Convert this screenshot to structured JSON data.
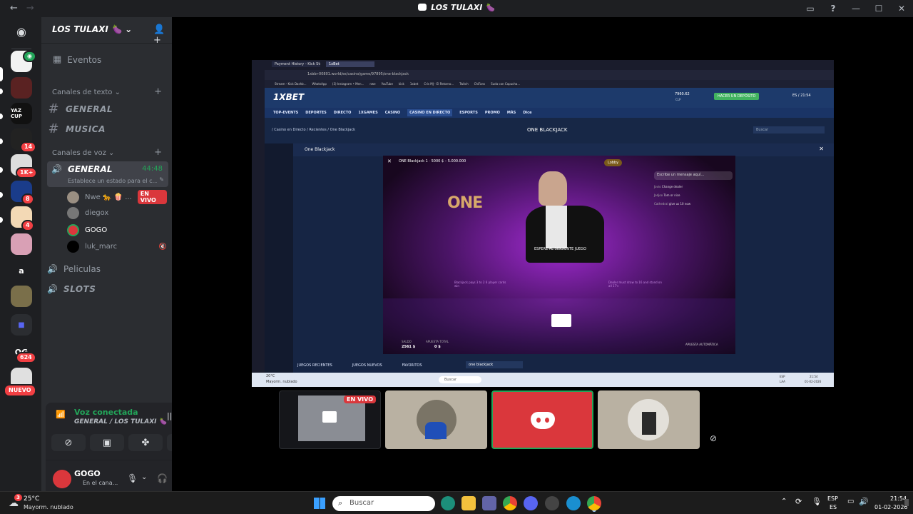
{
  "window": {
    "title": "LOS TULAXI 🍆",
    "back": "←",
    "forward": "→"
  },
  "colors": {
    "accent_green": "#23a559",
    "live_red": "#da373c",
    "badge_red": "#f23f43",
    "discord_blurple": "#5865f2",
    "bet_green": "#41b35f"
  },
  "guild_badges": [
    {
      "count": "14"
    },
    {
      "count": "1K+"
    },
    {
      "count": "8"
    },
    {
      "count": "4"
    },
    {
      "count": "624"
    }
  ],
  "guild_misc": {
    "new_label": "NUEVO",
    "og_label": "OG"
  },
  "server": {
    "name": "LOS TULAXI 🍆"
  },
  "sidebar": {
    "events": "Eventos",
    "text_category": "Canales de texto",
    "text_channels": [
      "GENERAL",
      "MUSICA"
    ],
    "voice_category": "Canales de voz",
    "active_voice": {
      "name": "GENERAL",
      "timer": "44:48",
      "status_hint": "Establece un estado para el c..."
    },
    "voice_members": [
      {
        "name": "Nwe 🐆 🍿 ...",
        "live": "EN VIVO"
      },
      {
        "name": "diegox"
      },
      {
        "name": "GOGO"
      },
      {
        "name": "luk_marc"
      }
    ],
    "other_voice": [
      "Peliculas",
      "SLOTS"
    ]
  },
  "voice_panel": {
    "status": "Voz conectada",
    "channel": "GENERAL / LOS TULAXI 🍆"
  },
  "user": {
    "name": "GOGO",
    "status": "En el cana..."
  },
  "stream": {
    "browser_tabs": [
      "Payment History - Kick Str...",
      "1xBet"
    ],
    "url": "1xbbr-00801.world/es/casino/game/97895/one-blackjack",
    "bookmarks": [
      "Stream - Kick Dashb...",
      "WhatsApp",
      "(3) Instagram • Men...",
      "nwe",
      "YouTube",
      "kick",
      "1xbet",
      "Cris MJ - El Retorno...",
      "Twitch",
      "ChiFans",
      "Suda con Capucha..."
    ],
    "logo": "1XBET",
    "nav": [
      "TOP-EVENTS",
      "DEPORTES",
      "DIRECTO",
      "1XGAMES",
      "CASINO",
      "CASINO EN DIRECTO",
      "ESPORTS",
      "PROMO",
      "MÁS",
      "Dice"
    ],
    "balance": "7960.62",
    "balance_currency": "CLP",
    "deposit_button": "HACER UN DEPÓSITO",
    "lang_time": "ES / 21:54",
    "breadcrumb": "/ Casino en Directo / Recientes / One Blackjack",
    "page_title": "ONE BLACKJACK",
    "search_placeholder": "Buscar",
    "game_panel_title": "One Blackjack",
    "game_title": "ONE Blackjack 1 · 5000 $ – 5.000.000",
    "lobby": "Lobby",
    "chat_placeholder": "Escribe un mensaje aquí...",
    "chat": [
      {
        "user": "Jovio",
        "text": "Change dealer"
      },
      {
        "user": "Jodjoo",
        "text": "Tom or nice"
      },
      {
        "user": "Cathedral",
        "text": "give us 10 now"
      }
    ],
    "wait_text": "ESPERE AL SIGUIENTE JUEGO",
    "table_left": "Blackjack pays 3 to 2  6 player cards win",
    "table_right": "Dealer must draw to 16 and stand on all 17's",
    "saldo_label": "SALDO",
    "saldo_value": "2561 $",
    "apuesta_label": "APUESTA TOTAL",
    "apuesta_value": "0 $",
    "autobet": "APUESTA AUTOMÁTICA",
    "bottom_tabs": [
      "JUEGOS RECIENTES",
      "JUEGOS NUEVOS",
      "FAVORITOS"
    ],
    "bottom_search": "one blackjack",
    "inner_taskbar": {
      "weather": "20°C",
      "weather_desc": "Mayorm. nublado",
      "search": "Buscar",
      "lang1": "ESP",
      "lang2": "LAA",
      "time": "21:54",
      "date": "01-02-2026"
    }
  },
  "tiles": {
    "live_label": "EN VIVO"
  },
  "taskbar": {
    "temp": "25°C",
    "weather": "Mayorm. nublado",
    "weather_badge": "3",
    "search": "Buscar",
    "lang": "ESP",
    "lang_sub": "ES",
    "time": "21:54",
    "date": "01-02-2026"
  }
}
